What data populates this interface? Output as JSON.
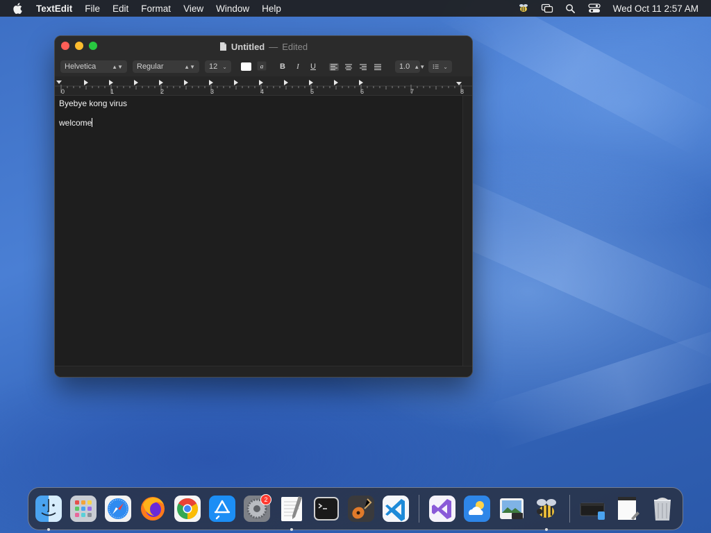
{
  "menubar": {
    "app_name": "TextEdit",
    "items": [
      "File",
      "Edit",
      "Format",
      "View",
      "Window",
      "Help"
    ],
    "clock": "Wed Oct 11  2:57 AM"
  },
  "window": {
    "title": "Untitled",
    "separator": "—",
    "status": "Edited"
  },
  "toolbar": {
    "font_family": "Helvetica",
    "font_style": "Regular",
    "font_size": "12",
    "bold_label": "B",
    "italic_label": "I",
    "underline_label": "U",
    "line_spacing": "1.0"
  },
  "ruler": {
    "numbers": [
      "0",
      "1",
      "2",
      "3",
      "4",
      "5",
      "6",
      "7",
      "8"
    ]
  },
  "document": {
    "line1": "Byebye kong virus",
    "line2": "welcome"
  },
  "dock": {
    "items": [
      "Finder",
      "Launchpad",
      "Safari",
      "Firefox",
      "Chrome",
      "App Store",
      "System Settings",
      "TextEdit",
      "Terminal",
      "GarageBand",
      "Visual Studio Code",
      "Visual Studio",
      "Weather",
      "Preview",
      "Cyberduck",
      "Window Preview",
      "TextEdit Preview",
      "Trash"
    ],
    "settings_badge": "2"
  },
  "colors": {
    "close": "#ff5f57",
    "minimize": "#febc2e",
    "zoom": "#28c840",
    "window_bg": "#1e1e1e"
  }
}
